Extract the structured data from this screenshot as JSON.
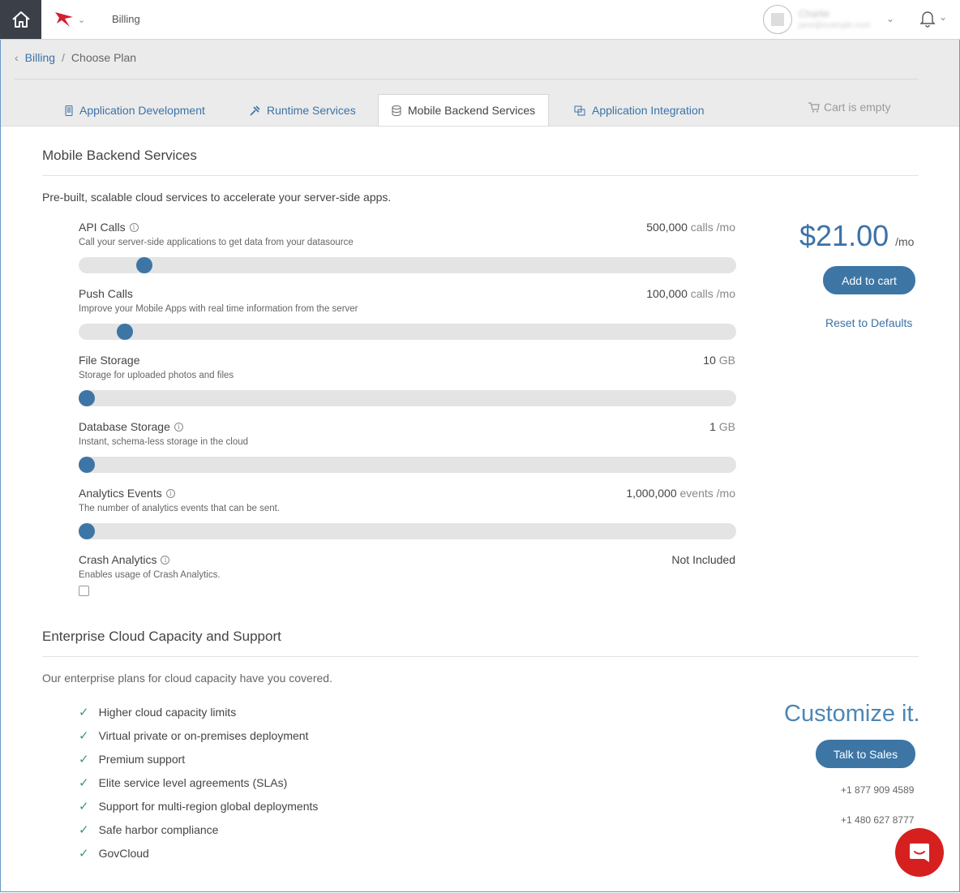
{
  "topbar": {
    "section": "Billing",
    "user_name": "Charlie",
    "user_email": "jane@example.com"
  },
  "breadcrumb": {
    "back": "Billing",
    "separator": "/",
    "current": "Choose Plan"
  },
  "tabs": [
    {
      "label": "Application Development",
      "icon": "mobile-icon"
    },
    {
      "label": "Runtime Services",
      "icon": "tools-icon"
    },
    {
      "label": "Mobile Backend Services",
      "icon": "database-icon",
      "active": true
    },
    {
      "label": "Application Integration",
      "icon": "integration-icon"
    }
  ],
  "cart": {
    "label": "Cart is empty"
  },
  "section1": {
    "title": "Mobile Backend Services",
    "intro": "Pre-built, scalable cloud services to accelerate your server-side apps."
  },
  "rows": [
    {
      "label": "API Calls",
      "desc": "Call your server-side applications to get data from your datasource",
      "value": "500,000",
      "unit": " calls /mo",
      "level": 0.09
    },
    {
      "label": "Push Calls",
      "desc": "Improve your Mobile Apps with real time information from the server",
      "value": "100,000",
      "unit": " calls /mo",
      "level": 0.06
    },
    {
      "label": "File Storage",
      "desc": "Storage for uploaded photos and files",
      "value": "10",
      "unit": " GB",
      "level": 0.0
    },
    {
      "label": "Database Storage",
      "desc": "Instant, schema-less storage in the cloud",
      "value": "1",
      "unit": " GB",
      "level": 0.0
    },
    {
      "label": "Analytics Events",
      "desc": "The number of analytics events that can be sent.",
      "value": "1,000,000",
      "unit": " events /mo",
      "level": 0.0
    },
    {
      "label": "Crash Analytics",
      "desc": "Enables usage of Crash Analytics.",
      "value": "Not Included",
      "unit": ""
    }
  ],
  "pricing": {
    "amount": "$21.00",
    "period": "/mo",
    "add_to_cart": "Add to cart",
    "reset": "Reset to Defaults"
  },
  "section2": {
    "title": "Enterprise Cloud Capacity and Support",
    "intro": "Our enterprise plans for cloud capacity have you covered.",
    "features": [
      "Higher cloud capacity limits",
      "Virtual private or on-premises deployment",
      "Premium support",
      "Elite service level agreements (SLAs)",
      "Support for multi-region global deployments",
      "Safe harbor compliance",
      "GovCloud"
    ],
    "customize": "Customize it.",
    "talk_to_sales": "Talk to Sales",
    "phones": [
      "+1 877 909 4589",
      "+1 480 627 8777"
    ]
  },
  "colors": {
    "accent": "#3d76a5",
    "link": "#3b72a8",
    "chat": "#d62020"
  }
}
